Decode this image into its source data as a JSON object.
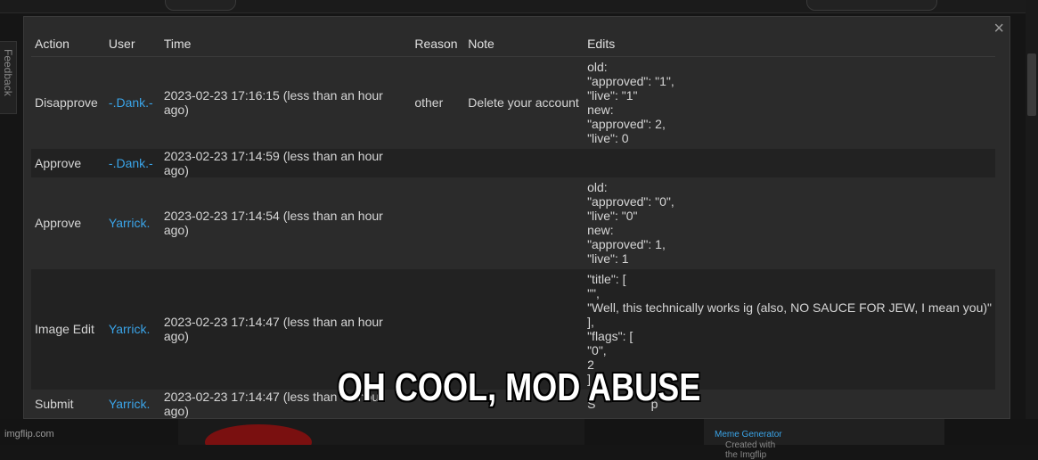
{
  "feedback_tab": "Feedback",
  "modal": {
    "close_icon": "×",
    "columns": [
      "Action",
      "User",
      "Time",
      "Reason",
      "Note",
      "Edits"
    ],
    "rows": [
      {
        "action": "Disapprove",
        "user": "-.Dank.-",
        "time": "2023-02-23 17:16:15 (less than an hour ago)",
        "reason": "other",
        "note": "Delete your account",
        "edits": "old:\n\"approved\": \"1\",\n\"live\": \"1\"\nnew:\n\"approved\": 2,\n\"live\": 0"
      },
      {
        "action": "Approve",
        "user": "-.Dank.-",
        "time": "2023-02-23 17:14:59 (less than an hour ago)",
        "reason": "",
        "note": "",
        "edits": ""
      },
      {
        "action": "Approve",
        "user": "Yarrick.",
        "time": "2023-02-23 17:14:54 (less than an hour ago)",
        "reason": "",
        "note": "",
        "edits": "old:\n\"approved\": \"0\",\n\"live\": \"0\"\nnew:\n\"approved\": 1,\n\"live\": 1"
      },
      {
        "action": "Image Edit",
        "user": "Yarrick.",
        "time": "2023-02-23 17:14:47 (less than an hour ago)",
        "reason": "",
        "note": "",
        "edits": "\"title\": [\n\"\",\n\"Well, this technically works ig (also, NO SAUCE FOR JEW, I mean you)\"\n],\n\"flags\": [\n\"0\",\n2\n]"
      },
      {
        "action": "Submit",
        "user": "Yarrick.",
        "time": "2023-02-23 17:14:47 (less than an hour ago)",
        "reason": "",
        "note": "",
        "edits": "S                p"
      }
    ]
  },
  "caption": "OH COOL, MOD ABUSE",
  "watermark": "imgflip.com",
  "credit": {
    "prefix": "Created with the Imgflip ",
    "link": "Meme Generator"
  }
}
